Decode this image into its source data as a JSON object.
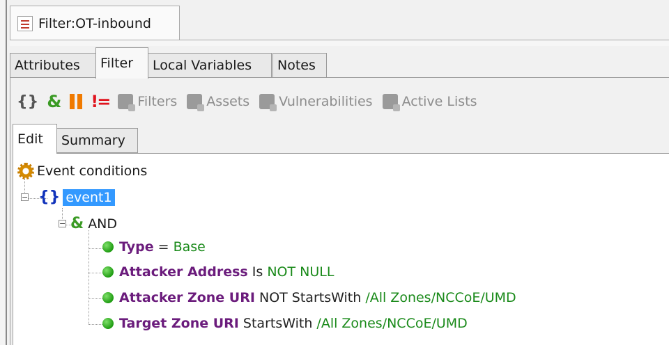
{
  "window": {
    "title": "Filter:OT-inbound"
  },
  "tabs": [
    {
      "label": "Attributes"
    },
    {
      "label": "Filter"
    },
    {
      "label": "Local Variables"
    },
    {
      "label": "Notes"
    }
  ],
  "toolbar": {
    "filters": "Filters",
    "assets": "Assets",
    "vulnerabilities": "Vulnerabilities",
    "active_lists": "Active Lists"
  },
  "subtabs": [
    {
      "label": "Edit"
    },
    {
      "label": "Summary"
    }
  ],
  "tree": {
    "root": "Event conditions",
    "event": "event1",
    "and": "AND",
    "conditions": [
      {
        "field": "Type",
        "op": "=",
        "value": "Base"
      },
      {
        "field": "Attacker Address",
        "op": "Is",
        "value": "NOT NULL"
      },
      {
        "field": "Attacker Zone URI",
        "op": "NOT StartsWith",
        "value": "/All Zones/NCCoE/UMD"
      },
      {
        "field": "Target Zone URI",
        "op": "StartsWith",
        "value": "/All Zones/NCCoE/UMD"
      }
    ]
  },
  "colors": {
    "field": "#6b1c7c",
    "value": "#1a8a1a",
    "selection": "#3399ff"
  }
}
